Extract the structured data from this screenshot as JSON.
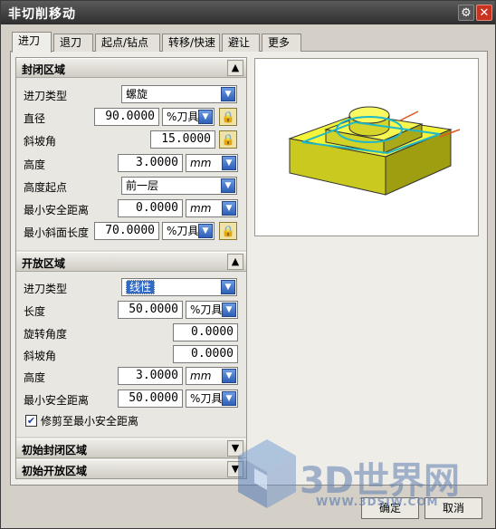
{
  "window": {
    "title": "非切削移动"
  },
  "tabs": [
    {
      "label": "进刀",
      "active": true
    },
    {
      "label": "退刀"
    },
    {
      "label": "起点/钻点"
    },
    {
      "label": "转移/快速"
    },
    {
      "label": "避让"
    },
    {
      "label": "更多"
    }
  ],
  "closed_area": {
    "title": "封闭区域",
    "engage_type_label": "进刀类型",
    "engage_type_value": "螺旋",
    "diameter_label": "直径",
    "diameter_value": "90.0000",
    "diameter_unit": "%刀具",
    "ramp_angle_label": "斜坡角",
    "ramp_angle_value": "15.0000",
    "height_label": "高度",
    "height_value": "3.0000",
    "height_unit": "mm",
    "height_from_label": "高度起点",
    "height_from_value": "前一层",
    "min_clearance_label": "最小安全距离",
    "min_clearance_value": "0.0000",
    "min_clearance_unit": "mm",
    "min_ramp_length_label": "最小斜面长度",
    "min_ramp_length_value": "70.0000",
    "min_ramp_length_unit": "%刀具"
  },
  "open_area": {
    "title": "开放区域",
    "engage_type_label": "进刀类型",
    "engage_type_value": "线性",
    "length_label": "长度",
    "length_value": "50.0000",
    "length_unit": "%刀具",
    "rotation_label": "旋转角度",
    "rotation_value": "0.0000",
    "ramp_angle_label": "斜坡角",
    "ramp_angle_value": "0.0000",
    "height_label": "高度",
    "height_value": "3.0000",
    "height_unit": "mm",
    "min_clearance_label": "最小安全距离",
    "min_clearance_value": "50.0000",
    "min_clearance_unit": "%刀具",
    "trim_label": "修剪至最小安全距离",
    "trim_checked": true
  },
  "collapsed_sections": [
    "初始封闭区域",
    "初始开放区域"
  ],
  "buttons": {
    "ok": "确定",
    "cancel": "取消"
  },
  "watermark": {
    "text": "3D世界网",
    "url": "WWW.3DSJW.COM"
  },
  "icons": {
    "lock": "lock-icon",
    "dropdown": "dropdown-arrow-icon",
    "collapse": "chevron-up-icon",
    "expand": "chevron-down-icon",
    "gear": "gear-icon",
    "close": "close-icon"
  },
  "colors": {
    "titlebar": "#2e2e2e",
    "close": "#c8321e",
    "dropdown": "#2f5fb8",
    "part": "#e8e830",
    "part_path": "#30c0d0"
  }
}
